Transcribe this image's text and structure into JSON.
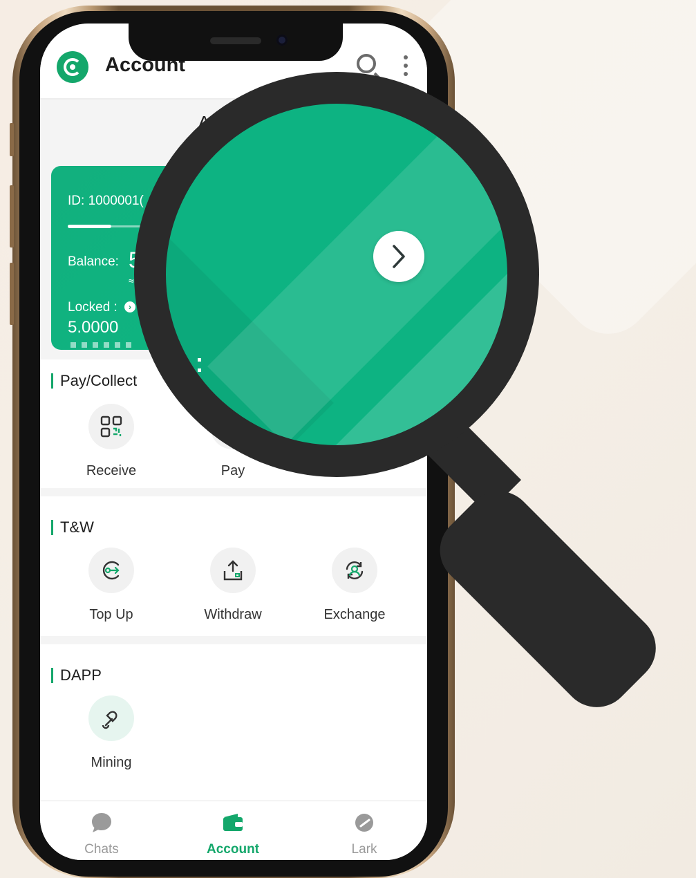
{
  "header": {
    "title": "Account",
    "subtitle_fragment": "A"
  },
  "card": {
    "id_label": "ID:",
    "id_value": "1000001(",
    "progress": 0.45,
    "balance_label": "Balance:",
    "balance_value": "5",
    "approx": "≈",
    "locked_label": "Locked :",
    "locked_value": "5.0000"
  },
  "sections": {
    "pay_collect": {
      "title": "Pay/Collect",
      "items": [
        {
          "label": "Receive",
          "icon": "qr-code-icon"
        },
        {
          "label": "Pay",
          "icon": "pay-icon"
        }
      ]
    },
    "tw": {
      "title": "T&W",
      "items": [
        {
          "label": "Top Up",
          "icon": "top-up-icon"
        },
        {
          "label": "Withdraw",
          "icon": "withdraw-icon"
        },
        {
          "label": "Exchange",
          "icon": "exchange-icon"
        }
      ]
    },
    "dapp": {
      "title": "DAPP",
      "items": [
        {
          "label": "Mining",
          "icon": "mining-icon"
        }
      ]
    }
  },
  "nav": [
    {
      "label": "Chats",
      "icon": "chat-bubble-icon",
      "active": false
    },
    {
      "label": "Account",
      "icon": "wallet-icon",
      "active": true
    },
    {
      "label": "Lark",
      "icon": "lark-icon",
      "active": false
    }
  ],
  "colors": {
    "accent": "#14a76b",
    "card": "#10b07f",
    "magnifier": "#2a2a2a",
    "background": "#f5eee6"
  }
}
